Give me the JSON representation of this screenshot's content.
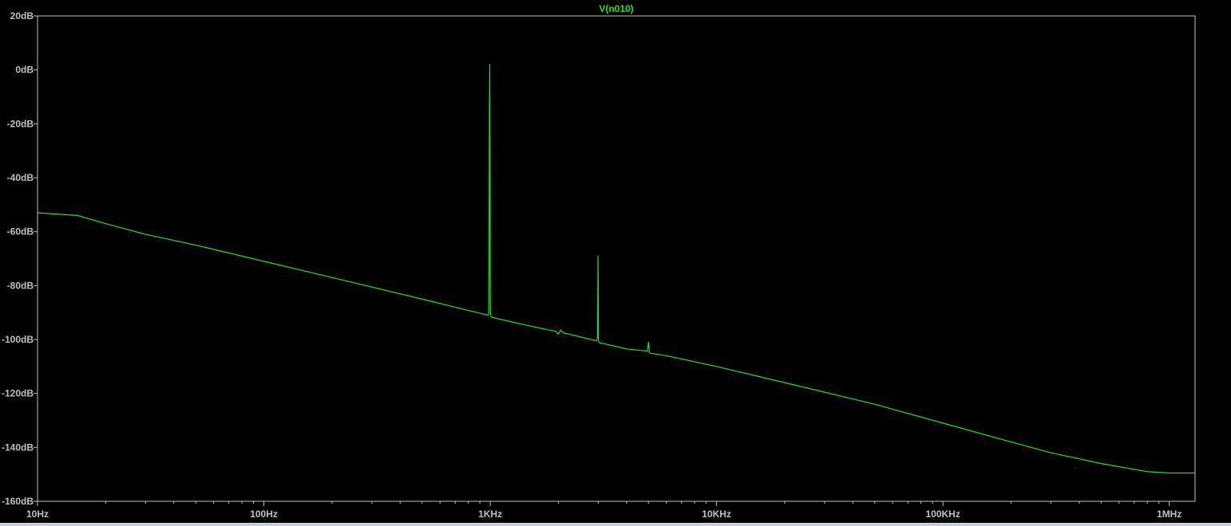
{
  "colors": {
    "background": "#000000",
    "frame": "#c0c0c0",
    "text": "#c0c0c0",
    "trace": "#22e022"
  },
  "chart_data": {
    "type": "line",
    "title": "V(n010)",
    "xscale": "log",
    "xlim": [
      10,
      1300000
    ],
    "ylim": [
      -160,
      20
    ],
    "grid": false,
    "y_ticks": [
      {
        "value": 20,
        "label": "20dB"
      },
      {
        "value": 0,
        "label": "0dB"
      },
      {
        "value": -20,
        "label": "-20dB"
      },
      {
        "value": -40,
        "label": "-40dB"
      },
      {
        "value": -60,
        "label": "-60dB"
      },
      {
        "value": -80,
        "label": "-80dB"
      },
      {
        "value": -100,
        "label": "-100dB"
      },
      {
        "value": -120,
        "label": "-120dB"
      },
      {
        "value": -140,
        "label": "-140dB"
      },
      {
        "value": -160,
        "label": "-160dB"
      }
    ],
    "x_ticks": [
      {
        "value": 10,
        "label": "10Hz"
      },
      {
        "value": 100,
        "label": "100Hz"
      },
      {
        "value": 1000,
        "label": "1KHz"
      },
      {
        "value": 10000,
        "label": "10KHz"
      },
      {
        "value": 100000,
        "label": "100KHz"
      },
      {
        "value": 1000000,
        "label": "1MHz"
      }
    ],
    "series": [
      {
        "name": "V(n010)",
        "x": [
          10,
          15,
          20,
          30,
          50,
          100,
          200,
          500,
          980,
          985,
          988,
          990,
          992,
          995,
          998,
          1000,
          1002,
          1005,
          1008,
          1012,
          1015,
          1020,
          1500,
          1950,
          2000,
          2050,
          2100,
          2500,
          2950,
          2980,
          2995,
          3000,
          3005,
          3020,
          3050,
          4000,
          4950,
          5000,
          5050,
          6000,
          10000,
          20000,
          50000,
          100000,
          200000,
          300000,
          500000,
          800000,
          1000000,
          1300000
        ],
        "y": [
          -53,
          -54,
          -57,
          -61,
          -65,
          -71,
          -77,
          -85,
          -91,
          -90,
          -75,
          -45,
          -14,
          2,
          -30,
          -80,
          -91,
          -91.2,
          -91.4,
          -91.6,
          -91.7,
          -91.8,
          -95,
          -97,
          -98,
          -96.5,
          -97.5,
          -99,
          -100.5,
          -99,
          -69,
          -80,
          -100,
          -101,
          -101.2,
          -103.5,
          -104.3,
          -101,
          -105,
          -106,
          -110,
          -116,
          -124,
          -131,
          -138,
          -142,
          -146,
          -149,
          -149.5,
          -149.5
        ]
      }
    ]
  }
}
